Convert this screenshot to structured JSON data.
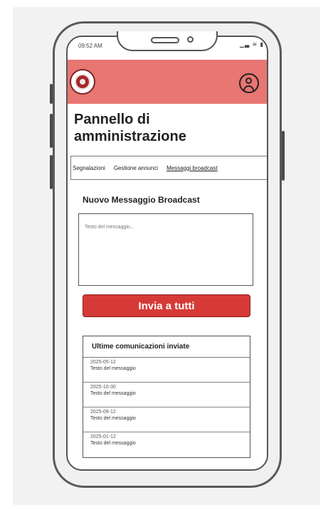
{
  "status_bar": {
    "time": "09:52 AM",
    "icons": "▁▃ ≋ ▮"
  },
  "header": {
    "logo": "university-seal",
    "profile": "profile-icon"
  },
  "page": {
    "title": "Pannello di amministrazione"
  },
  "tabs": [
    {
      "label": "Segnalazioni"
    },
    {
      "label": "Gestione annunci"
    },
    {
      "label": "Messaggi broadcast",
      "active": true
    }
  ],
  "broadcast": {
    "section_title": "Nuovo Messaggio Broadcast",
    "placeholder": "Testo del messaggio...",
    "send_label": "Invia a tutti"
  },
  "history": {
    "title": "Ultime comunicazioni inviate",
    "items": [
      {
        "date": "2025-05-12",
        "text": "Testo del messaggio"
      },
      {
        "date": "2025-10-30",
        "text": "Testo del messaggio"
      },
      {
        "date": "2025-09-12",
        "text": "Testo del messaggio"
      },
      {
        "date": "2025-01-12",
        "text": "Testo del messaggio"
      }
    ]
  },
  "colors": {
    "header": "#e87673",
    "button": "#d63a37",
    "logo": "#a3282b"
  }
}
